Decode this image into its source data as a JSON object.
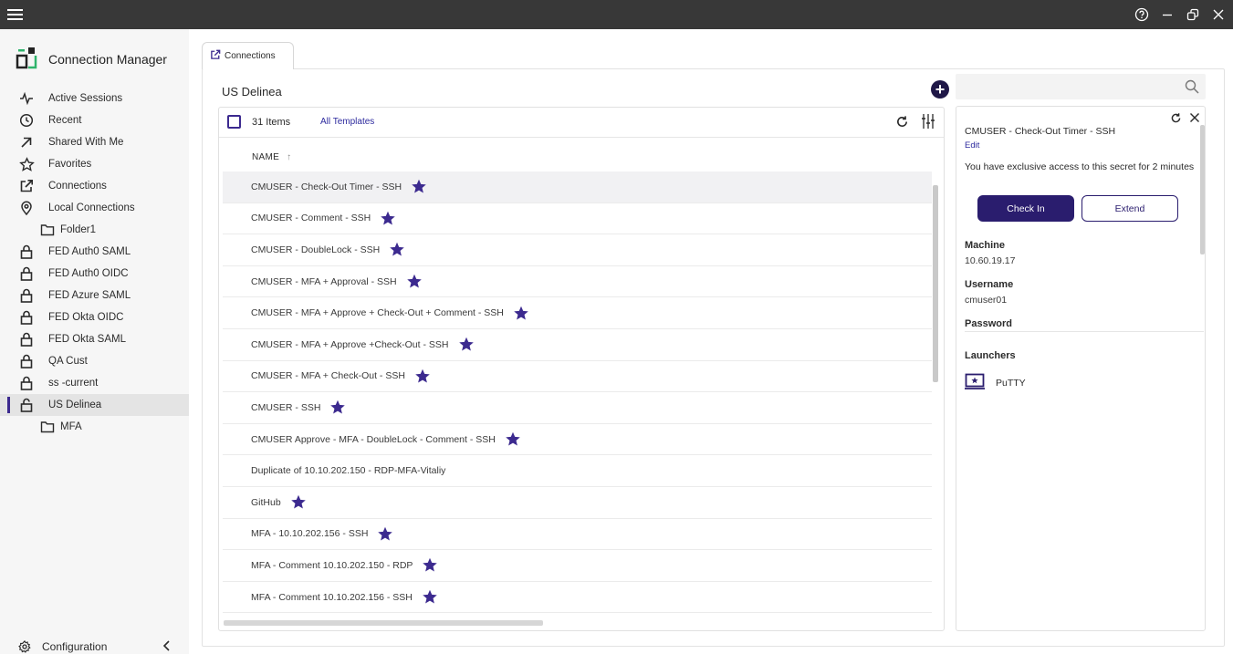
{
  "app": {
    "title": "Connection Manager",
    "accent_color": "#2a1d6e",
    "titlebar_color": "#383838"
  },
  "titlebar": {
    "icons": [
      "hamburger-menu-icon",
      "help-icon",
      "minimize-icon",
      "restore-icon",
      "close-icon"
    ]
  },
  "sidebar": {
    "items": [
      {
        "label": "Active Sessions",
        "icon": "activity-icon"
      },
      {
        "label": "Recent",
        "icon": "clock-icon"
      },
      {
        "label": "Shared With Me",
        "icon": "arrow-up-right-icon"
      },
      {
        "label": "Favorites",
        "icon": "star-outline-icon"
      },
      {
        "label": "Connections",
        "icon": "external-link-icon"
      },
      {
        "label": "Local Connections",
        "icon": "location-pin-icon"
      },
      {
        "label": "Folder1",
        "icon": "folder-icon",
        "sub": true
      },
      {
        "label": "FED Auth0 SAML",
        "icon": "lock-icon"
      },
      {
        "label": "FED Auth0 OIDC",
        "icon": "lock-icon"
      },
      {
        "label": "FED Azure SAML",
        "icon": "lock-icon"
      },
      {
        "label": "FED Okta OIDC",
        "icon": "lock-icon"
      },
      {
        "label": "FED Okta SAML",
        "icon": "lock-icon"
      },
      {
        "label": "QA Cust",
        "icon": "lock-icon"
      },
      {
        "label": "ss -current",
        "icon": "lock-icon"
      },
      {
        "label": "US Delinea",
        "icon": "unlock-icon",
        "active": true
      },
      {
        "label": "MFA",
        "icon": "folder-icon",
        "sub": true
      }
    ],
    "config_label": "Configuration"
  },
  "main": {
    "tab_label": "Connections",
    "folder_title": "US Delinea",
    "item_count": "31 Items",
    "templates_link": "All Templates",
    "column_name": "NAME",
    "sort_arrow": "↑",
    "rows": [
      {
        "name": "CMUSER - Check-Out Timer - SSH",
        "favorite": true,
        "selected": true
      },
      {
        "name": "CMUSER - Comment - SSH",
        "favorite": true
      },
      {
        "name": "CMUSER - DoubleLock - SSH",
        "favorite": true
      },
      {
        "name": "CMUSER - MFA + Approval - SSH",
        "favorite": true
      },
      {
        "name": "CMUSER - MFA + Approve + Check-Out + Comment - SSH",
        "favorite": true
      },
      {
        "name": "CMUSER - MFA + Approve +Check-Out - SSH",
        "favorite": true
      },
      {
        "name": "CMUSER - MFA + Check-Out - SSH",
        "favorite": true
      },
      {
        "name": "CMUSER - SSH",
        "favorite": true
      },
      {
        "name": "CMUSER Approve - MFA - DoubleLock - Comment - SSH",
        "favorite": true
      },
      {
        "name": "Duplicate of 10.10.202.150 - RDP-MFA-Vitaliy",
        "favorite": false
      },
      {
        "name": "GitHub",
        "favorite": true
      },
      {
        "name": "MFA - 10.10.202.156 - SSH",
        "favorite": true
      },
      {
        "name": "MFA - Comment 10.10.202.150 - RDP",
        "favorite": true
      },
      {
        "name": "MFA - Comment 10.10.202.156 - SSH",
        "favorite": true
      }
    ]
  },
  "search": {
    "placeholder": ""
  },
  "details": {
    "title": "CMUSER - Check-Out Timer - SSH",
    "edit_label": "Edit",
    "notice": "You have exclusive access to this secret for 2 minutes",
    "checkin_label": "Check In",
    "extend_label": "Extend",
    "machine_label": "Machine",
    "machine_value": "10.60.19.17",
    "username_label": "Username",
    "username_value": "cmuser01",
    "password_label": "Password",
    "launchers_label": "Launchers",
    "launcher_name": "PuTTY"
  }
}
